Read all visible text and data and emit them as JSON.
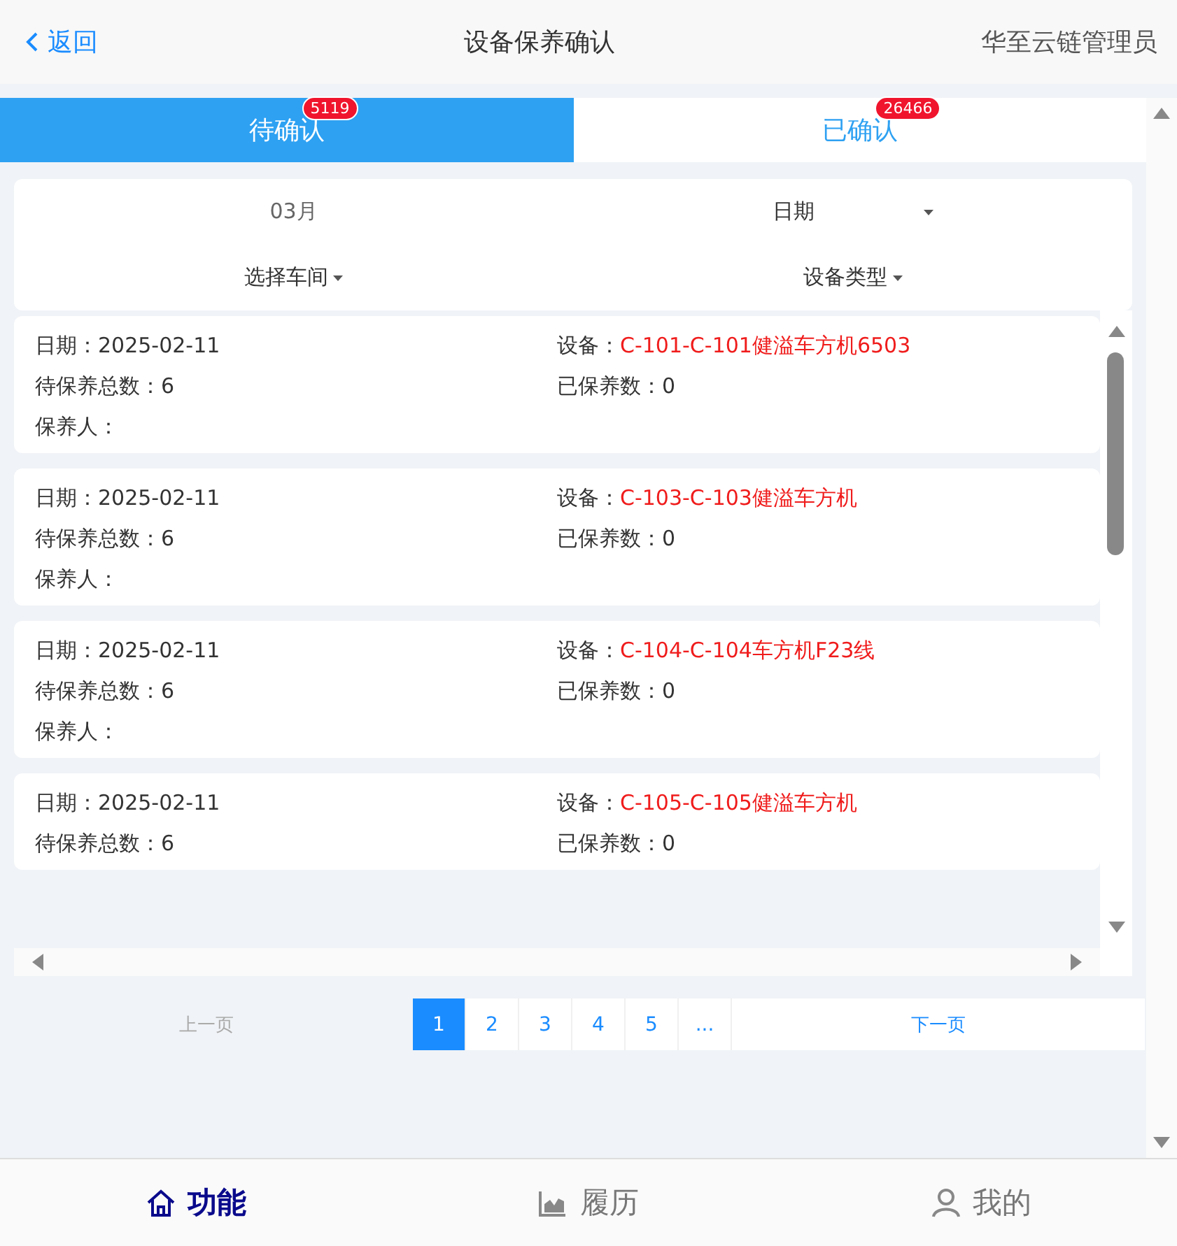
{
  "header": {
    "back": "返回",
    "title": "设备保养确认",
    "user": "华至云链管理员"
  },
  "tabs": [
    {
      "label": "待确认",
      "badge": "5119",
      "selected": true
    },
    {
      "label": "已确认",
      "badge": "26466",
      "selected": false
    }
  ],
  "filters": {
    "month": "03月",
    "date": "日期",
    "workshop": "选择车间",
    "device_type": "设备类型"
  },
  "records": [
    {
      "date_label": "日期：",
      "date": "2025-02-11",
      "device_label": "设备：",
      "device": "C-101-C-101健溢车方机6503",
      "total_label": "待保养总数：",
      "total": "6",
      "done_label": "已保养数：",
      "done": "0",
      "person_label": "保养人："
    },
    {
      "date_label": "日期：",
      "date": "2025-02-11",
      "device_label": "设备：",
      "device": "C-103-C-103健溢车方机",
      "total_label": "待保养总数：",
      "total": "6",
      "done_label": "已保养数：",
      "done": "0",
      "person_label": "保养人："
    },
    {
      "date_label": "日期：",
      "date": "2025-02-11",
      "device_label": "设备：",
      "device": "C-104-C-104车方机F23线",
      "total_label": "待保养总数：",
      "total": "6",
      "done_label": "已保养数：",
      "done": "0",
      "person_label": "保养人："
    },
    {
      "date_label": "日期：",
      "date": "2025-02-11",
      "device_label": "设备：",
      "device": "C-105-C-105健溢车方机",
      "total_label": "待保养总数：",
      "total": "6",
      "done_label": "已保养数：",
      "done": "0"
    }
  ],
  "pagination": {
    "prev": "上一页",
    "pages": [
      {
        "label": "1",
        "selected": true
      },
      {
        "label": "2",
        "selected": false
      },
      {
        "label": "3",
        "selected": false
      },
      {
        "label": "4",
        "selected": false
      },
      {
        "label": "5",
        "selected": false
      },
      {
        "label": "...",
        "selected": false
      }
    ],
    "next": "下一页"
  },
  "nav": [
    {
      "kind": "home",
      "label": "功能",
      "selected": true
    },
    {
      "kind": "chart",
      "label": "履历",
      "selected": false
    },
    {
      "kind": "user",
      "label": "我的",
      "selected": false
    }
  ]
}
